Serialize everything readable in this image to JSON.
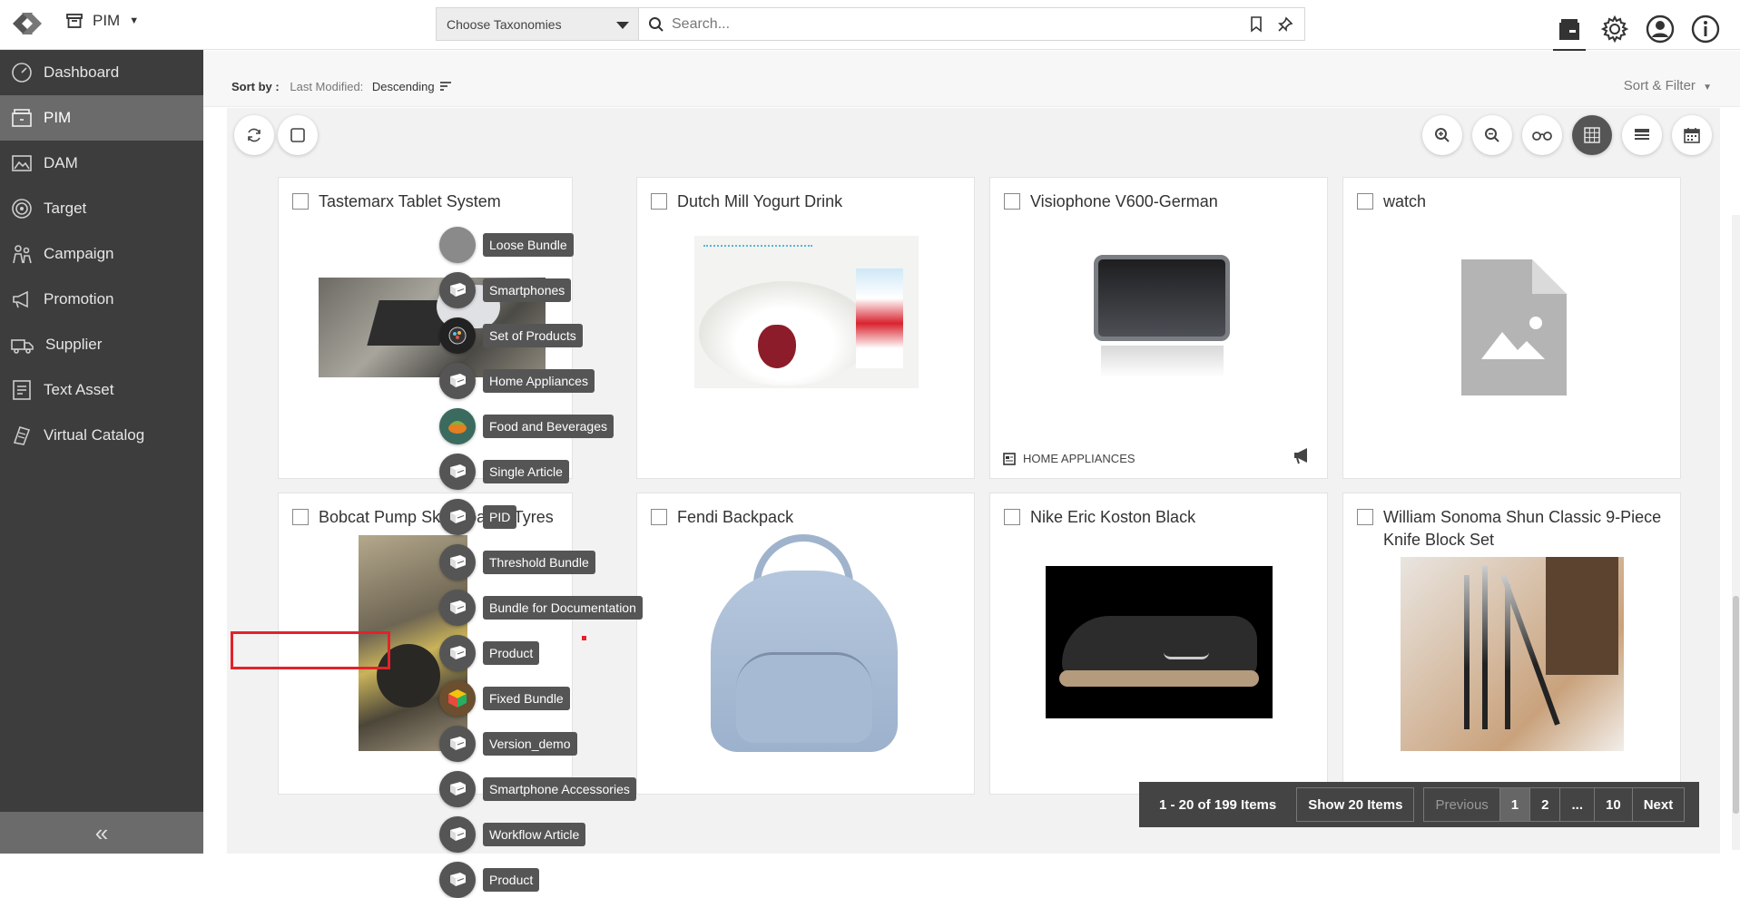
{
  "header": {
    "app_name": "PIM",
    "taxonomy_placeholder": "Choose Taxonomies",
    "search_placeholder": "Search..."
  },
  "sidebar": {
    "items": [
      {
        "label": "Dashboard",
        "icon": "dashboard-icon"
      },
      {
        "label": "PIM",
        "icon": "pim-icon",
        "active": true
      },
      {
        "label": "DAM",
        "icon": "dam-icon"
      },
      {
        "label": "Target",
        "icon": "target-icon"
      },
      {
        "label": "Campaign",
        "icon": "campaign-icon"
      },
      {
        "label": "Promotion",
        "icon": "promotion-icon"
      },
      {
        "label": "Supplier",
        "icon": "supplier-icon"
      },
      {
        "label": "Text Asset",
        "icon": "text-asset-icon"
      },
      {
        "label": "Virtual Catalog",
        "icon": "virtual-catalog-icon"
      }
    ],
    "collapse_label": "«"
  },
  "sort": {
    "label": "Sort by :",
    "field": "Last Modified:",
    "direction": "Descending",
    "sort_filter": "Sort & Filter"
  },
  "cards": [
    {
      "title": "Tastemarx Tablet System"
    },
    {
      "title": "Dutch Mill Yogurt Drink"
    },
    {
      "title": "Visiophone V600-German",
      "footer": "HOME APPLIANCES"
    },
    {
      "title": "watch"
    },
    {
      "title": "Bobcat Pump Skid-Loader Tyres"
    },
    {
      "title": "Fendi Backpack"
    },
    {
      "title": "Nike Eric Koston Black"
    },
    {
      "title": "William Sonoma Shun Classic 9-Piece Knife Block Set"
    }
  ],
  "bundle_menu": [
    "Loose Bundle",
    "Smartphones",
    "Set of Products",
    "Home Appliances",
    "Food and Beverages",
    "Single Article",
    "PID",
    "Threshold Bundle",
    "Bundle for Documentation",
    "Product",
    "Fixed Bundle",
    "Version_demo",
    "Smartphone Accessories",
    "Workflow Article",
    "Product"
  ],
  "pagination": {
    "summary": "1 - 20 of 199 Items",
    "show": "Show 20 Items",
    "previous": "Previous",
    "pages": [
      "1",
      "2",
      "...",
      "10"
    ],
    "next": "Next"
  },
  "colors": {
    "sidebar": "#3d3d3d",
    "sidebar_active": "#6b6b6b",
    "highlight": "#e3222a"
  }
}
